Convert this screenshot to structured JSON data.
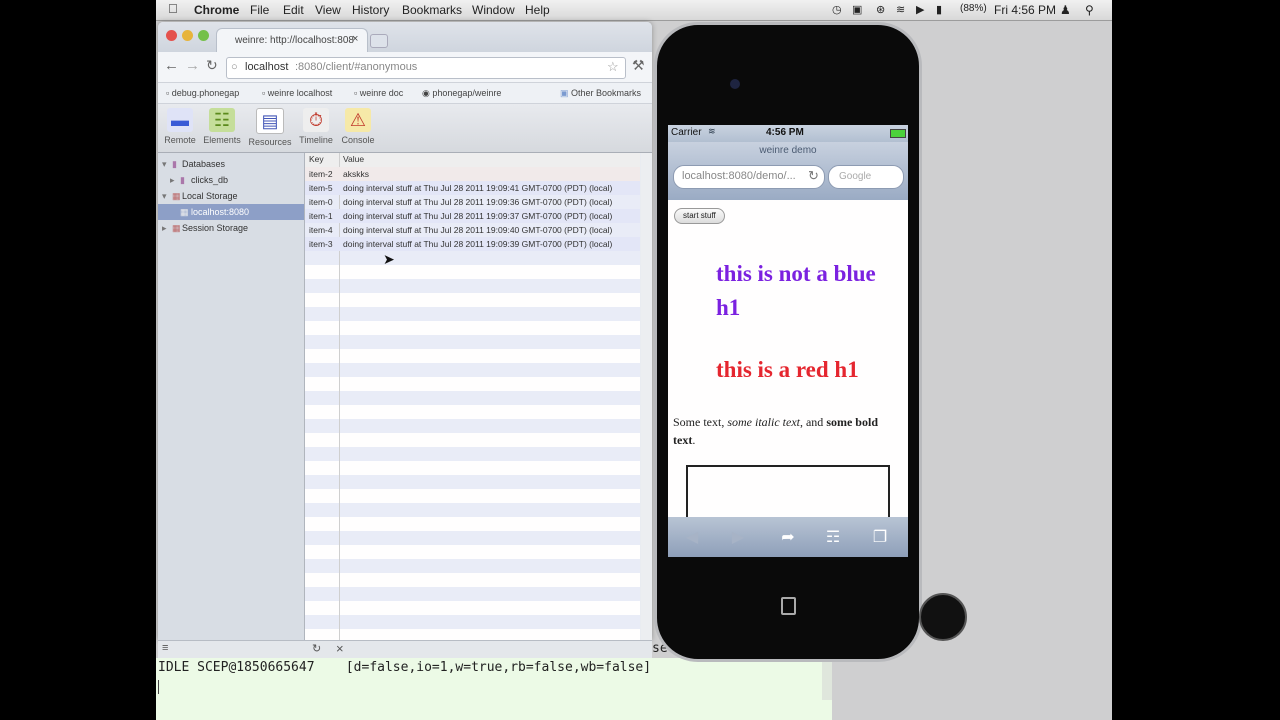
{
  "menubar": {
    "app": "Chrome",
    "items": [
      "File",
      "Edit",
      "View",
      "History",
      "Bookmarks",
      "Window",
      "Help"
    ],
    "battery": "(88%)",
    "clock": "Fri 4:56 PM"
  },
  "browser": {
    "tab_title": "weinre: http://localhost:808",
    "address_host": "localhost",
    "address_path": ":8080/client/#anonymous",
    "bookmarks": [
      "debug.phonegap",
      "weinre localhost",
      "weinre doc",
      "phonegap/weinre"
    ],
    "other_bookmarks": "Other Bookmarks"
  },
  "devtools": {
    "tools": [
      "Remote",
      "Elements",
      "Resources",
      "Timeline",
      "Console"
    ],
    "sidebar": {
      "databases": "Databases",
      "db_item": "clicks_db",
      "local_storage": "Local Storage",
      "local_item": "localhost:8080",
      "session_storage": "Session Storage"
    },
    "grid": {
      "col_key": "Key",
      "col_value": "Value",
      "rows": [
        {
          "key": "item-2",
          "value": "akskks"
        },
        {
          "key": "item-5",
          "value": "doing interval stuff at Thu Jul 28 2011 19:09:41 GMT-0700 (PDT) (local)"
        },
        {
          "key": "item-0",
          "value": "doing interval stuff at Thu Jul 28 2011 19:09:36 GMT-0700 (PDT) (local)"
        },
        {
          "key": "item-1",
          "value": "doing interval stuff at Thu Jul 28 2011 19:09:37 GMT-0700 (PDT) (local)"
        },
        {
          "key": "item-4",
          "value": "doing interval stuff at Thu Jul 28 2011 19:09:40 GMT-0700 (PDT) (local)"
        },
        {
          "key": "item-3",
          "value": "doing interval stuff at Thu Jul 28 2011 19:09:39 GMT-0700 (PDT) (local)"
        }
      ]
    }
  },
  "terminal": {
    "line": "IDLE SCEP@1850665647    [d=false,io=1,w=true,rb=false,wb=false]",
    "partial": "se"
  },
  "phone": {
    "carrier": "Carrier",
    "time": "4:56 PM",
    "page_title": "weinre demo",
    "url": "localhost:8080/demo/...",
    "search_placeholder": "Google",
    "button": "start stuff",
    "h1_blue": "this is not a blue h1",
    "h1_red": "this is a red h1",
    "text_1": "Some text, ",
    "text_italic": "some italic text",
    "text_2": ", and ",
    "text_bold": "some bold text",
    "text_3": "."
  },
  "colors": {
    "h1_blue": "#7b21e0",
    "h1_red": "#e5262f",
    "selection": "#8d9fc7"
  }
}
